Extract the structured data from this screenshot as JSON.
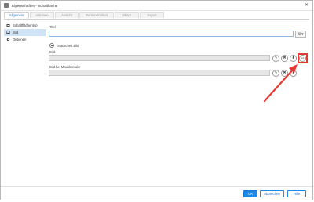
{
  "window": {
    "title": "Eigenschaften - Schaltfläche",
    "close_glyph": "✕"
  },
  "tabs": [
    {
      "label": "Allgemein",
      "active": true
    },
    {
      "label": "Aktionen",
      "active": false
    },
    {
      "label": "Ansicht",
      "active": false
    },
    {
      "label": "Barrierefreiheit",
      "active": false
    },
    {
      "label": "Skript",
      "active": false
    },
    {
      "label": "Export",
      "active": false
    }
  ],
  "sidebar": {
    "items": [
      {
        "label": "Schaltflächentyp",
        "icon": "button-type-icon",
        "selected": false
      },
      {
        "label": "Bild",
        "icon": "image-icon",
        "selected": true
      },
      {
        "label": "Optionen",
        "icon": "gear-icon",
        "selected": false
      }
    ]
  },
  "form": {
    "title_label": "Titel",
    "title_value": "",
    "static_image_label": "Statisches Bild",
    "image_label": "Bild",
    "image_value": "",
    "hover_image_label": "Bild bei Mauskontakt",
    "hover_image_value": ""
  },
  "icons": {
    "edit": "✎",
    "clear": "✖",
    "download": "⬇",
    "alt_text": "Alt",
    "gear_dropdown": "⚙▾"
  },
  "footer": {
    "ok": "OK",
    "cancel": "Abbrechen",
    "help": "Hilfe"
  },
  "colors": {
    "accent": "#1e88e5",
    "highlight": "#e53935"
  }
}
